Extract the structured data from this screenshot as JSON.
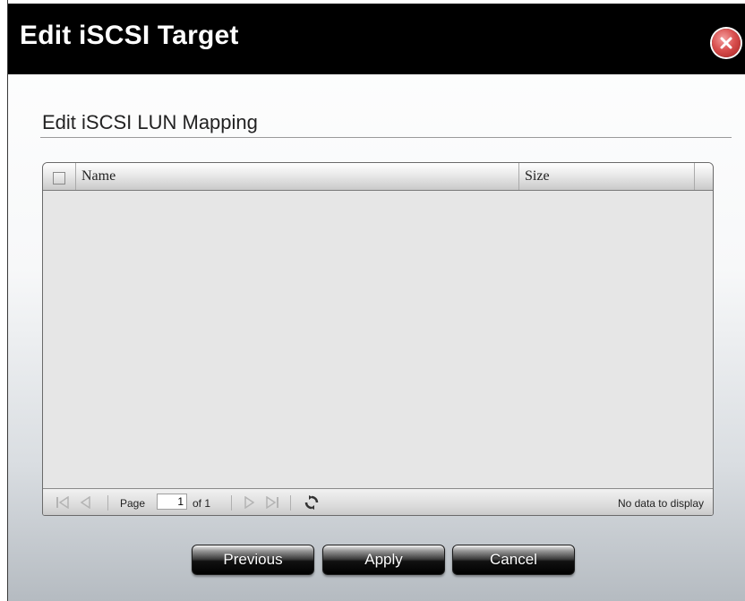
{
  "dialog": {
    "title": "Edit iSCSI Target",
    "section_title": "Edit iSCSI LUN Mapping"
  },
  "grid": {
    "columns": [
      "Name",
      "Size"
    ],
    "rows": []
  },
  "pager": {
    "page_label": "Page",
    "current_page": "1",
    "of_label": "of 1",
    "status_text": "No data to display"
  },
  "buttons": {
    "previous": "Previous",
    "apply": "Apply",
    "cancel": "Cancel"
  },
  "icons": {
    "close": "close-icon",
    "first": "first-page-icon",
    "prev": "prev-page-icon",
    "next": "next-page-icon",
    "last": "last-page-icon",
    "refresh": "refresh-icon"
  },
  "colors": {
    "titlebar": "#000000",
    "close": "#d9504f"
  }
}
